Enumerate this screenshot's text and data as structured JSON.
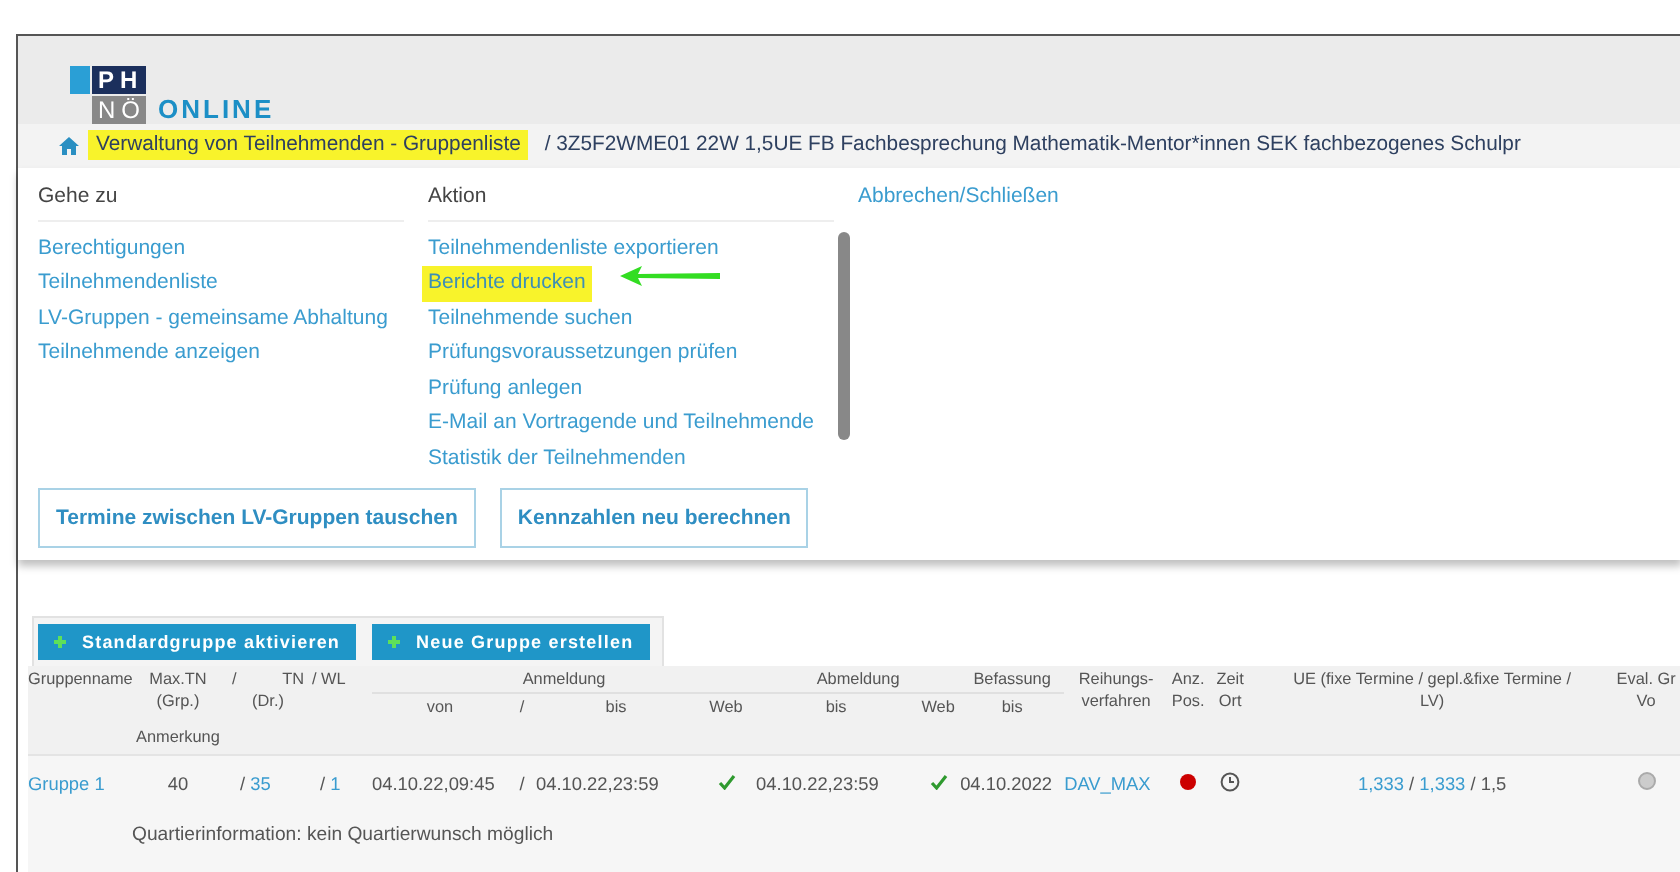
{
  "logo": {
    "top": "PH",
    "bottom": "NÖ",
    "word": "ONLINE"
  },
  "breadcrumb": [
    {
      "text": "Verwaltung von Teilnehmenden - Gruppenliste",
      "highlighted": true
    },
    {
      "text": "/ 3Z5F2WME01 22W 1,5UE FB Fachbesprechung Mathematik-Mentor*innen SEK fachbezogenes Schulpr",
      "highlighted": false
    }
  ],
  "menu": {
    "goto": {
      "title": "Gehe zu",
      "items": [
        {
          "label": "Berechtigungen",
          "highlighted": false
        },
        {
          "label": "Teilnehmendenliste",
          "highlighted": false
        },
        {
          "label": "LV-Gruppen - gemeinsame Abhaltung",
          "highlighted": false
        },
        {
          "label": "Teilnehmende anzeigen",
          "highlighted": false
        }
      ]
    },
    "action": {
      "title": "Aktion",
      "items": [
        {
          "label": "Teilnehmendenliste exportieren",
          "highlighted": false
        },
        {
          "label": "Berichte drucken",
          "highlighted": true
        },
        {
          "label": "Teilnehmende suchen",
          "highlighted": false
        },
        {
          "label": "Prüfungsvoraussetzungen prüfen",
          "highlighted": false
        },
        {
          "label": "Prüfung anlegen",
          "highlighted": false
        },
        {
          "label": "E-Mail an Vortragende und Teilnehmende",
          "highlighted": false
        },
        {
          "label": "Statistik der Teilnehmenden",
          "highlighted": false
        }
      ]
    },
    "cancel": "Abbrechen/Schließen"
  },
  "panel_buttons": [
    "Termine zwischen LV-Gruppen tauschen",
    "Kennzahlen neu berechnen"
  ],
  "toolbar_buttons": [
    "Standardgruppe aktivieren",
    "Neue Gruppe erstellen"
  ],
  "table": {
    "header": {
      "gruppenname": "Gruppenname",
      "max_tn": [
        "Max.TN",
        "(Grp.)"
      ],
      "tn": [
        "/",
        "TN",
        "(Dr.)"
      ],
      "wl": "/ WL",
      "anmeldung": {
        "title": "Anmeldung",
        "von": "von",
        "sep": "/",
        "bis": "bis",
        "web": "Web"
      },
      "abmeldung": {
        "title": "Abmeldung",
        "bis": "bis",
        "web": "Web"
      },
      "befassung": {
        "title": "Befassung",
        "bis": "bis"
      },
      "reihung": [
        "Reihungs-",
        "verfahren"
      ],
      "anz_pos": [
        "Anz.",
        "Pos."
      ],
      "zeit_ort": [
        "Zeit",
        "Ort"
      ],
      "ue": [
        "UE (fixe Termine / gepl.&fixe Termine /",
        "LV)"
      ],
      "eval": [
        "Eval. Gr",
        "Vo"
      ],
      "anmerkung": "Anmerkung"
    },
    "rows": [
      {
        "name": "Gruppe 1",
        "max_tn": "40",
        "tn_sep": "/",
        "tn": "35",
        "wl_sep": "/",
        "wl": "1",
        "anm_von": "04.10.22,09:45",
        "anm_sep": "/",
        "anm_bis": "04.10.22,23:59",
        "anm_web": true,
        "abm_bis": "04.10.22,23:59",
        "abm_web": true,
        "bef_bis": "04.10.2022",
        "reihung": "DAV_MAX",
        "color": "#cc0000",
        "ue_fixe": "1,333",
        "ue_sep_1": "/",
        "ue_gepl": "1,333",
        "ue_sep_2": "/",
        "ue_lv": "1,5",
        "note": "Quartierinformation: kein Quartierwunsch möglich"
      }
    ]
  }
}
